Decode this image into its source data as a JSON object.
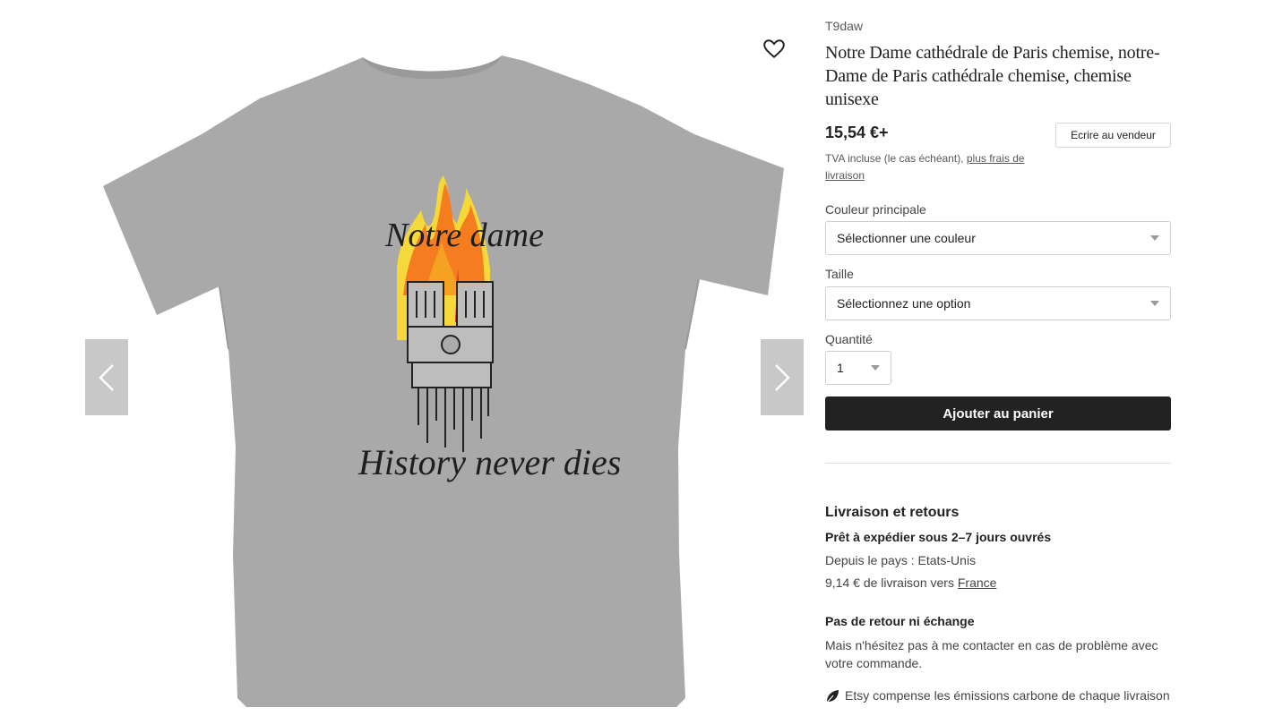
{
  "gallery": {
    "shirt_color": "#a9a9a9",
    "print_text_top": "Notre dame",
    "print_text_bottom": "History never dies",
    "prev_icon": "chevron-left-icon",
    "next_icon": "chevron-right-icon",
    "favorite_icon": "heart-icon"
  },
  "listing": {
    "shop_name": "T9daw",
    "title": "Notre Dame cathédrale de Paris chemise, notre-Dame de Paris cathédrale chemise, chemise unisexe",
    "price": "15,54 €+",
    "contact_label": "Ecrire au vendeur",
    "tax_text": "TVA incluse (le cas échéant), ",
    "tax_link": "plus frais de livraison"
  },
  "options": {
    "color_label": "Couleur principale",
    "color_value": "Sélectionner une couleur",
    "size_label": "Taille",
    "size_value": "Sélectionnez une option",
    "qty_label": "Quantité",
    "qty_value": "1"
  },
  "cart": {
    "label": "Ajouter au panier"
  },
  "shipping": {
    "title": "Livraison et retours",
    "ready": "Prêt à expédier sous 2–7 jours ouvrés",
    "origin": "Depuis le pays : Etats-Unis",
    "cost_text": "9,14 € de livraison vers ",
    "cost_link": "France",
    "returns_title": "Pas de retour ni échange",
    "returns_text": "Mais n'hésitez pas à me contacter en cas de problème avec votre commande.",
    "carbon_text": "Etsy compense les émissions carbone de chaque livraison",
    "carbon_icon": "leaf-icon"
  },
  "colors": {
    "button_dark": "#222222",
    "nav_gray": "#c8c8c8",
    "flame_orange": "#f57c1f",
    "flame_yellow": "#f5d83a"
  }
}
